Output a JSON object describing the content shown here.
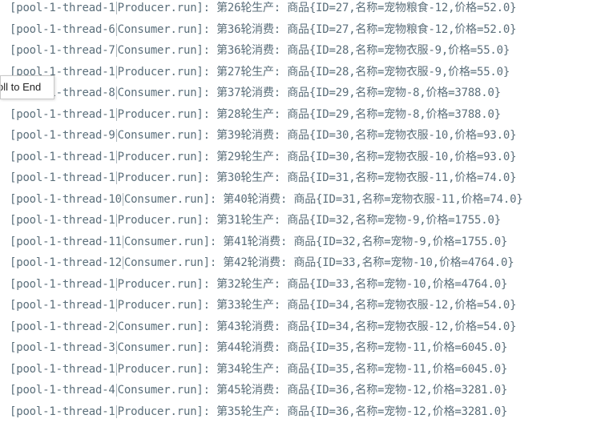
{
  "log": {
    "lines": [
      {
        "thread": "[pool-1-thread-1",
        "method": "Producer.run]: ",
        "message": "第26轮生产: 商品{ID=27,名称=宠物粮食-12,价格=52.0}"
      },
      {
        "thread": "[pool-1-thread-6",
        "method": "Consumer.run]: ",
        "message": "第36轮消费: 商品{ID=27,名称=宠物粮食-12,价格=52.0}"
      },
      {
        "thread": "[pool-1-thread-7",
        "method": "Consumer.run]: ",
        "message": "第36轮消费: 商品{ID=28,名称=宠物衣服-9,价格=55.0}"
      },
      {
        "thread": "[pool-1-thread-1",
        "method": "Producer.run]: ",
        "message": "第27轮生产: 商品{ID=28,名称=宠物衣服-9,价格=55.0}"
      },
      {
        "thread": "[pool-1-thread-8",
        "method": "Consumer.run]: ",
        "message": "第37轮消费: 商品{ID=29,名称=宠物-8,价格=3788.0}"
      },
      {
        "thread": "[pool-1-thread-1",
        "method": "Producer.run]: ",
        "message": "第28轮生产: 商品{ID=29,名称=宠物-8,价格=3788.0}"
      },
      {
        "thread": "[pool-1-thread-9",
        "method": "Consumer.run]: ",
        "message": "第39轮消费: 商品{ID=30,名称=宠物衣服-10,价格=93.0}"
      },
      {
        "thread": "[pool-1-thread-1",
        "method": "Producer.run]: ",
        "message": "第29轮生产: 商品{ID=30,名称=宠物衣服-10,价格=93.0}"
      },
      {
        "thread": "[pool-1-thread-1",
        "method": "Producer.run]: ",
        "message": "第30轮生产: 商品{ID=31,名称=宠物衣服-11,价格=74.0}"
      },
      {
        "thread": "[pool-1-thread-10",
        "method": "Consumer.run]: ",
        "message": "第40轮消费: 商品{ID=31,名称=宠物衣服-11,价格=74.0}"
      },
      {
        "thread": "[pool-1-thread-1",
        "method": "Producer.run]: ",
        "message": "第31轮生产: 商品{ID=32,名称=宠物-9,价格=1755.0}"
      },
      {
        "thread": "[pool-1-thread-11",
        "method": "Consumer.run]: ",
        "message": "第41轮消费: 商品{ID=32,名称=宠物-9,价格=1755.0}"
      },
      {
        "thread": "[pool-1-thread-12",
        "method": "Consumer.run]: ",
        "message": "第42轮消费: 商品{ID=33,名称=宠物-10,价格=4764.0}"
      },
      {
        "thread": "[pool-1-thread-1",
        "method": "Producer.run]: ",
        "message": "第32轮生产: 商品{ID=33,名称=宠物-10,价格=4764.0}"
      },
      {
        "thread": "[pool-1-thread-1",
        "method": "Producer.run]: ",
        "message": "第33轮生产: 商品{ID=34,名称=宠物衣服-12,价格=54.0}"
      },
      {
        "thread": "[pool-1-thread-2",
        "method": "Consumer.run]: ",
        "message": "第43轮消费: 商品{ID=34,名称=宠物衣服-12,价格=54.0}"
      },
      {
        "thread": "[pool-1-thread-3",
        "method": "Consumer.run]: ",
        "message": "第44轮消费: 商品{ID=35,名称=宠物-11,价格=6045.0}"
      },
      {
        "thread": "[pool-1-thread-1",
        "method": "Producer.run]: ",
        "message": "第34轮生产: 商品{ID=35,名称=宠物-11,价格=6045.0}"
      },
      {
        "thread": "[pool-1-thread-4",
        "method": "Consumer.run]: ",
        "message": "第45轮消费: 商品{ID=36,名称=宠物-12,价格=3281.0}"
      },
      {
        "thread": "[pool-1-thread-1",
        "method": "Producer.run]: ",
        "message": "第35轮生产: 商品{ID=36,名称=宠物-12,价格=3281.0}"
      }
    ]
  },
  "tooltip": {
    "label": "oll to End"
  },
  "colors": {
    "text": "#5b6f7b",
    "background": "#ffffff"
  }
}
